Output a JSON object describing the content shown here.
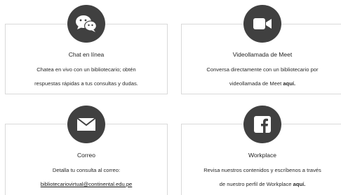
{
  "cards": [
    {
      "icon": "chat-bubbles-icon",
      "title": "Chat en línea",
      "desc_line1": "Chatea en vivo con un bibliotecario; obtén",
      "desc_line2": "respuestas rápidas a tus consultas y dudas."
    },
    {
      "icon": "video-camera-icon",
      "title": "Videollamada de Meet",
      "desc_line1": "Conversa directamente con un bibliotecario por",
      "desc_line2_prefix": "videollamada de Meet ",
      "desc_line2_link": "aquí."
    },
    {
      "icon": "envelope-icon",
      "title": "Correo",
      "desc_line1": "Detalla tu consulta al correo:",
      "desc_line2_link": "bibliotecariovirtual@continental.edu.pe"
    },
    {
      "icon": "facebook-icon",
      "title": "Workplace",
      "desc_line1": "Revisa nuestros contenidos y escríbenos a través",
      "desc_line2_prefix": "de nuestro perfil de Workplace ",
      "desc_line2_link": "aquí."
    }
  ],
  "colors": {
    "icon_circle": "#404040",
    "card_border": "#d9d9d9"
  }
}
